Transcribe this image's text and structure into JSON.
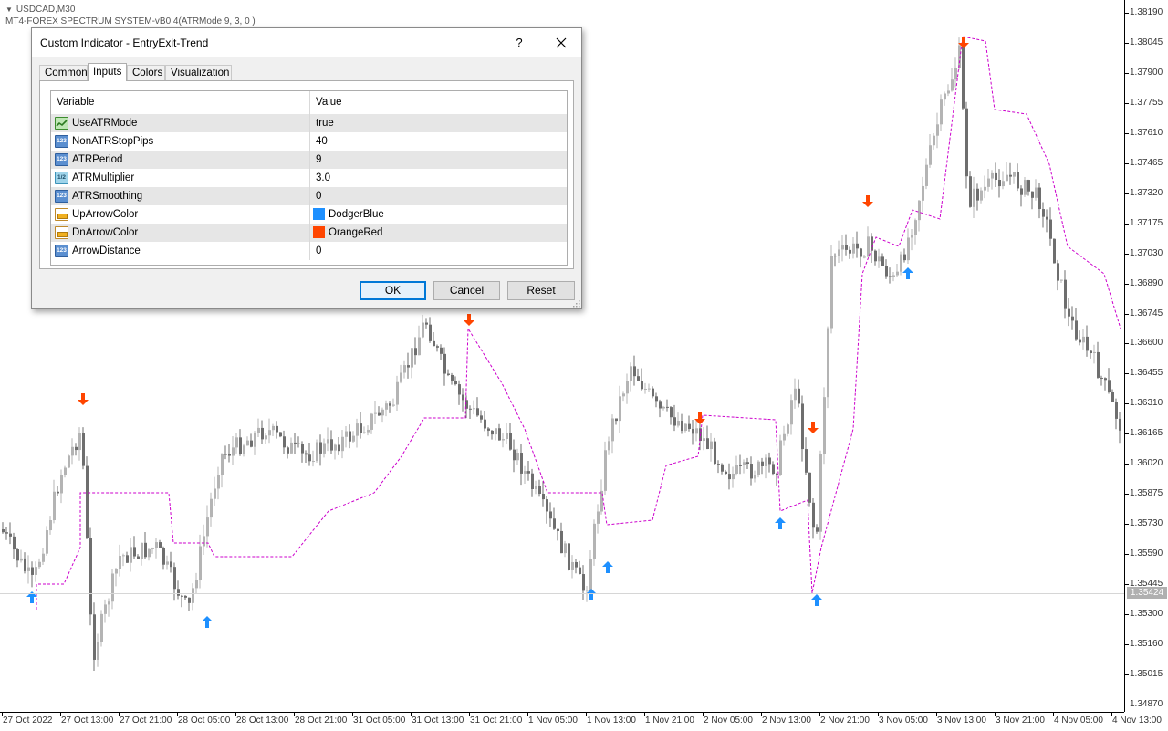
{
  "chart": {
    "symbol_line": "USDCAD,M30",
    "indicator_line": "MT4-FOREX SPECTRUM SYSTEM-vB0.4(ATRMode 9, 3, 0 )",
    "current_price": "1.35424",
    "price_axis": [
      "1.38190",
      "1.38045",
      "1.37900",
      "1.37755",
      "1.37610",
      "1.37465",
      "1.37320",
      "1.37175",
      "1.37030",
      "1.36890",
      "1.36745",
      "1.36600",
      "1.36455",
      "1.36310",
      "1.36165",
      "1.36020",
      "1.35875",
      "1.35730",
      "1.35590",
      "1.35445",
      "1.35300",
      "1.35160",
      "1.35015",
      "1.34870"
    ],
    "time_axis": [
      "27 Oct 2022",
      "27 Oct 13:00",
      "27 Oct 21:00",
      "28 Oct 05:00",
      "28 Oct 13:00",
      "28 Oct 21:00",
      "31 Oct 05:00",
      "31 Oct 13:00",
      "31 Oct 21:00",
      "1 Nov 05:00",
      "1 Nov 13:00",
      "1 Nov 21:00",
      "2 Nov 05:00",
      "2 Nov 13:00",
      "2 Nov 21:00",
      "3 Nov 05:00",
      "3 Nov 13:00",
      "3 Nov 21:00",
      "4 Nov 05:00",
      "4 Nov 13:00"
    ],
    "colors": {
      "bull_candle": "#b4b4b4",
      "bear_candle": "#6e6e6e",
      "stop_line": "#cc00cc",
      "up_arrow": "DodgerBlue",
      "down_arrow": "OrangeRed"
    }
  },
  "dialog": {
    "title": "Custom Indicator - EntryExit-Trend",
    "help_label": "?",
    "tabs": [
      {
        "label": "Common"
      },
      {
        "label": "Inputs"
      },
      {
        "label": "Colors"
      },
      {
        "label": "Visualization"
      }
    ],
    "active_tab": "Inputs",
    "columns": {
      "variable": "Variable",
      "value": "Value"
    },
    "params": [
      {
        "name": "UseATRMode",
        "value": "true",
        "icon": "bool-param-icon",
        "type": "bool"
      },
      {
        "name": "NonATRStopPips",
        "value": "40",
        "icon": "int-param-icon",
        "type": "num",
        "icon_text": "123"
      },
      {
        "name": "ATRPeriod",
        "value": "9",
        "icon": "int-param-icon",
        "type": "num",
        "icon_text": "123"
      },
      {
        "name": "ATRMultiplier",
        "value": "3.0",
        "icon": "double-param-icon",
        "type": "frac",
        "icon_text": "1/2"
      },
      {
        "name": "ATRSmoothing",
        "value": "0",
        "icon": "int-param-icon",
        "type": "num",
        "icon_text": "123"
      },
      {
        "name": "UpArrowColor",
        "value": "DodgerBlue",
        "icon": "color-param-icon",
        "type": "color",
        "swatch": "#1e90ff"
      },
      {
        "name": "DnArrowColor",
        "value": "OrangeRed",
        "icon": "color-param-icon",
        "type": "color",
        "swatch": "#ff4500"
      },
      {
        "name": "ArrowDistance",
        "value": "0",
        "icon": "int-param-icon",
        "type": "num",
        "icon_text": "123"
      }
    ],
    "buttons": {
      "ok": "OK",
      "cancel": "Cancel",
      "reset": "Reset"
    }
  }
}
